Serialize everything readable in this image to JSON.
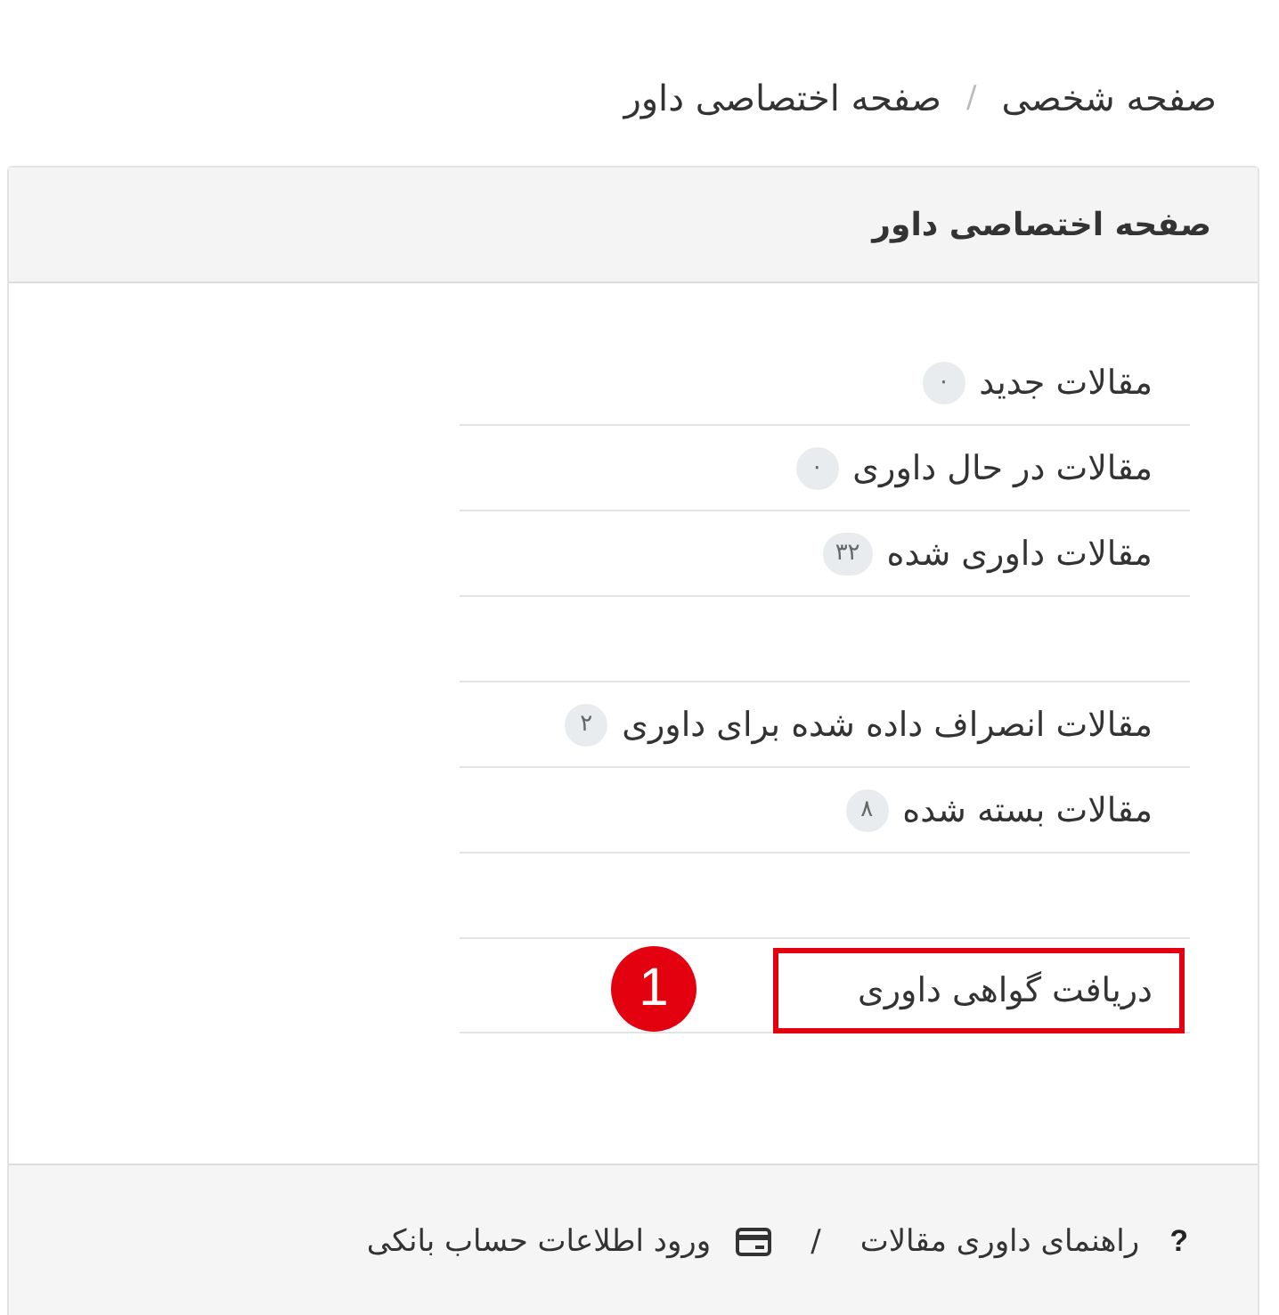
{
  "breadcrumb": {
    "items": [
      "صفحه شخصی",
      "صفحه اختصاصی داور"
    ],
    "separator": "/"
  },
  "panel": {
    "title": "صفحه اختصاصی داور",
    "items": [
      {
        "kind": "link",
        "label": "مقالات جدید",
        "count": "۰",
        "highlighted": false
      },
      {
        "kind": "link",
        "label": "مقالات در حال داوری",
        "count": "۰",
        "highlighted": false
      },
      {
        "kind": "link",
        "label": "مقالات داوری شده",
        "count": "۳۲",
        "highlighted": false
      },
      {
        "kind": "spacer"
      },
      {
        "kind": "link",
        "label": "مقالات انصراف داده شده برای داوری",
        "count": "۲",
        "highlighted": false
      },
      {
        "kind": "link",
        "label": "مقالات بسته شده",
        "count": "۸",
        "highlighted": false
      },
      {
        "kind": "spacer"
      },
      {
        "kind": "link",
        "label": "دریافت گواهی داوری",
        "highlighted": true,
        "callout": "1"
      }
    ],
    "footer": {
      "links": [
        {
          "kind": "glyph",
          "icon": "?",
          "label": "راهنمای داوری مقالات"
        },
        {
          "kind": "card",
          "label": "ورود اطلاعات حساب بانکی"
        }
      ],
      "separator": "/"
    }
  }
}
